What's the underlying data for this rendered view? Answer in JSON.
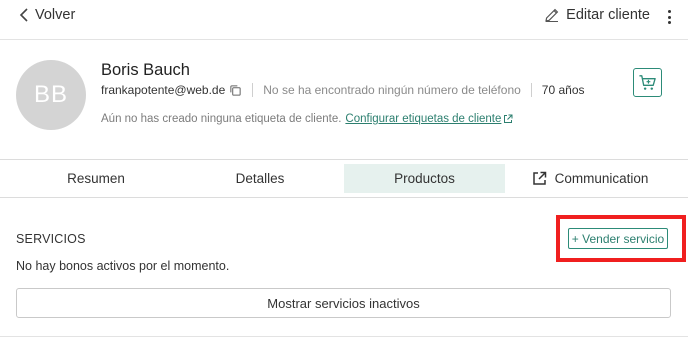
{
  "header": {
    "back_label": "Volver",
    "edit_label": "Editar cliente"
  },
  "customer": {
    "initials": "BB",
    "name": "Boris Bauch",
    "email": "frankapotente@web.de",
    "phone_text": "No se ha encontrado ningún número de teléfono",
    "age": "70 años",
    "tags_text": "Aún no has creado ninguna etiqueta de cliente.",
    "tags_link": "Configurar etiquetas de cliente"
  },
  "tabs": [
    {
      "label": "Resumen",
      "active": false
    },
    {
      "label": "Detalles",
      "active": false
    },
    {
      "label": "Productos",
      "active": true
    },
    {
      "label": "Communication",
      "active": false
    }
  ],
  "services": {
    "title": "SERVICIOS",
    "sell_label": "+ Vender servicio",
    "empty_text": "No hay bonos activos por el momento.",
    "show_inactive_label": "Mostrar servicios inactivos"
  },
  "colors": {
    "accent": "#2c8b78",
    "active_tab_bg": "#e6f1ee",
    "highlight": "#f01f1f"
  },
  "icons": [
    "chevron-left-icon",
    "pencil-icon",
    "more-vertical-icon",
    "copy-icon",
    "external-link-icon",
    "cart-icon"
  ]
}
